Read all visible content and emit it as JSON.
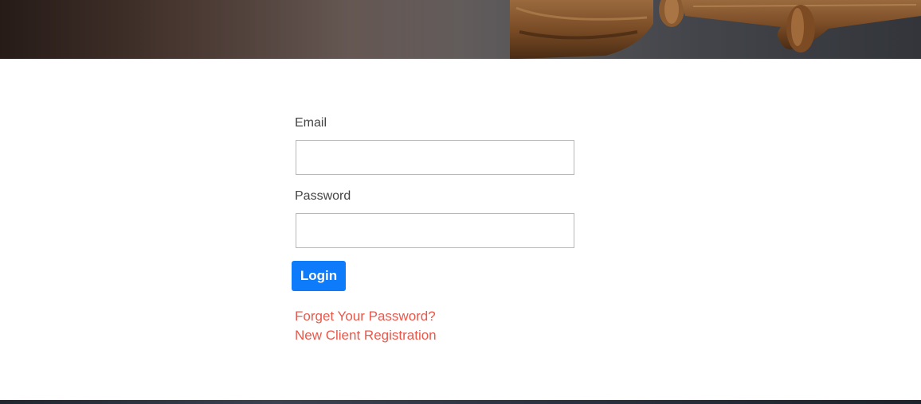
{
  "hero": {
    "image": "gavel-banner"
  },
  "login_form": {
    "email_label": "Email",
    "email_value": "",
    "password_label": "Password",
    "password_value": "",
    "login_button": "Login",
    "forgot_link": "Forget Your Password?",
    "register_link": "New Client Registration"
  },
  "colors": {
    "primary_button": "#0d7bfa",
    "link": "#e8584b",
    "label_text": "#444444"
  }
}
